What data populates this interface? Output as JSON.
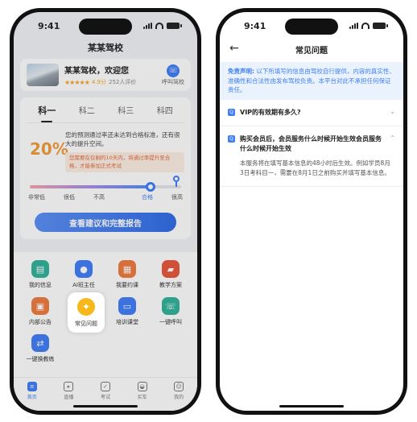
{
  "status": {
    "time": "9:41"
  },
  "left": {
    "title": "某某驾校",
    "school": {
      "name": "某某驾校，欢迎您",
      "stars": "★★★★★",
      "score": "4.9分",
      "reviews": "252人评价",
      "call_label": "呼叫驾校",
      "call_icon": "phone-icon"
    },
    "tabs": [
      "科一",
      "科二",
      "科三",
      "科四"
    ],
    "pass_rate": 20,
    "pass_rate_label": "20%",
    "pass_desc": "您的预测通过率还未达到合格标准，还有很大的提升空间。",
    "pass_note": "您需要在仅剩的10天内，将通过率提升至合格，才能参加正式考试",
    "levels": [
      "非常低",
      "很低",
      "不高",
      "",
      "合格",
      "很高"
    ],
    "report_button": "查看建议和完整报告",
    "grid": [
      {
        "label": "我的信息",
        "icon": "id-card-icon",
        "color": "#2fb39a"
      },
      {
        "label": "AI班主任",
        "icon": "person-icon",
        "color": "#3f7ef7"
      },
      {
        "label": "我要约课",
        "icon": "calendar-icon",
        "color": "#f07b3f"
      },
      {
        "label": "教学方案",
        "icon": "folder-icon",
        "color": "#e9563b"
      },
      {
        "label": "内部公告",
        "icon": "briefcase-icon",
        "color": "#f07b3f"
      },
      {
        "label": "常见问题",
        "icon": "lightbulb-icon",
        "color": "#f6b81a"
      },
      {
        "label": "培训课堂",
        "icon": "monitor-icon",
        "color": "#3f7ef7"
      },
      {
        "label": "一键呼叫",
        "icon": "phone-icon",
        "color": "#2fb39a"
      },
      {
        "label": "一键换教练",
        "icon": "person-swap-icon",
        "color": "#3f7ef7"
      }
    ],
    "tabbar": [
      "首页",
      "直播",
      "考试",
      "买车",
      "我的"
    ]
  },
  "right": {
    "title": "常见问题",
    "disclaimer_label": "免责声明:",
    "disclaimer_text": "以下所填写的信息由驾校自行提供，内容的真实性、准确性和合法性由发布驾校负责。本平台对此不承担任何保证责任。",
    "faqs": [
      {
        "q": "VIP的有效期有多久?",
        "a": "",
        "expanded": false
      },
      {
        "q": "购买会员后，会员服务什么时候开始生效会员服务什么时候开始生效",
        "a": "本服务将在填写基本信息的48小时后生效。例如学员8月3日考科目一，需要在8月1日之前购买并填写基本信息。",
        "expanded": true
      }
    ]
  },
  "colors": {
    "accent": "#3f7ef7",
    "warning": "#f29b38"
  }
}
